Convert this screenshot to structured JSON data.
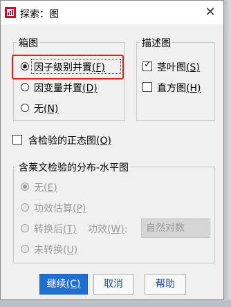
{
  "window": {
    "title": "探索：图",
    "close_glyph": "✕"
  },
  "boxplot_group": {
    "legend": "箱图",
    "options": [
      {
        "label": "因子级别并置",
        "mnemonic": "(F)",
        "selected": true
      },
      {
        "label": "因变量并置",
        "mnemonic": "(D)",
        "selected": false
      },
      {
        "label": "无",
        "mnemonic": "(N)",
        "selected": false
      }
    ]
  },
  "descriptive_group": {
    "legend": "描述图",
    "options": [
      {
        "label": "茎叶图",
        "mnemonic": "(S)",
        "checked": true
      },
      {
        "label": "直方图",
        "mnemonic": "(H)",
        "checked": false
      }
    ]
  },
  "normality": {
    "label": "含检验的正态图",
    "mnemonic": "(O)",
    "checked": false
  },
  "levene_group": {
    "legend": "含莱文检验的分布-水平图",
    "options": [
      {
        "label": "无",
        "mnemonic": "(E)",
        "selected": true
      },
      {
        "label": "功效估算",
        "mnemonic": "(P)",
        "selected": false
      },
      {
        "label": "转换后",
        "mnemonic": "(T)",
        "selected": false
      },
      {
        "label": "未转换",
        "mnemonic": "(U)",
        "selected": false
      }
    ],
    "power_label": "功效",
    "power_mnemonic": "(W)",
    "power_colon": ":",
    "power_value": "自然对数"
  },
  "buttons": {
    "continue": "继续",
    "continue_mnemonic": "(C)",
    "cancel": "取消",
    "help": "帮助"
  },
  "colors": {
    "accent": "#1f6fd1",
    "highlight": "#e02020"
  }
}
